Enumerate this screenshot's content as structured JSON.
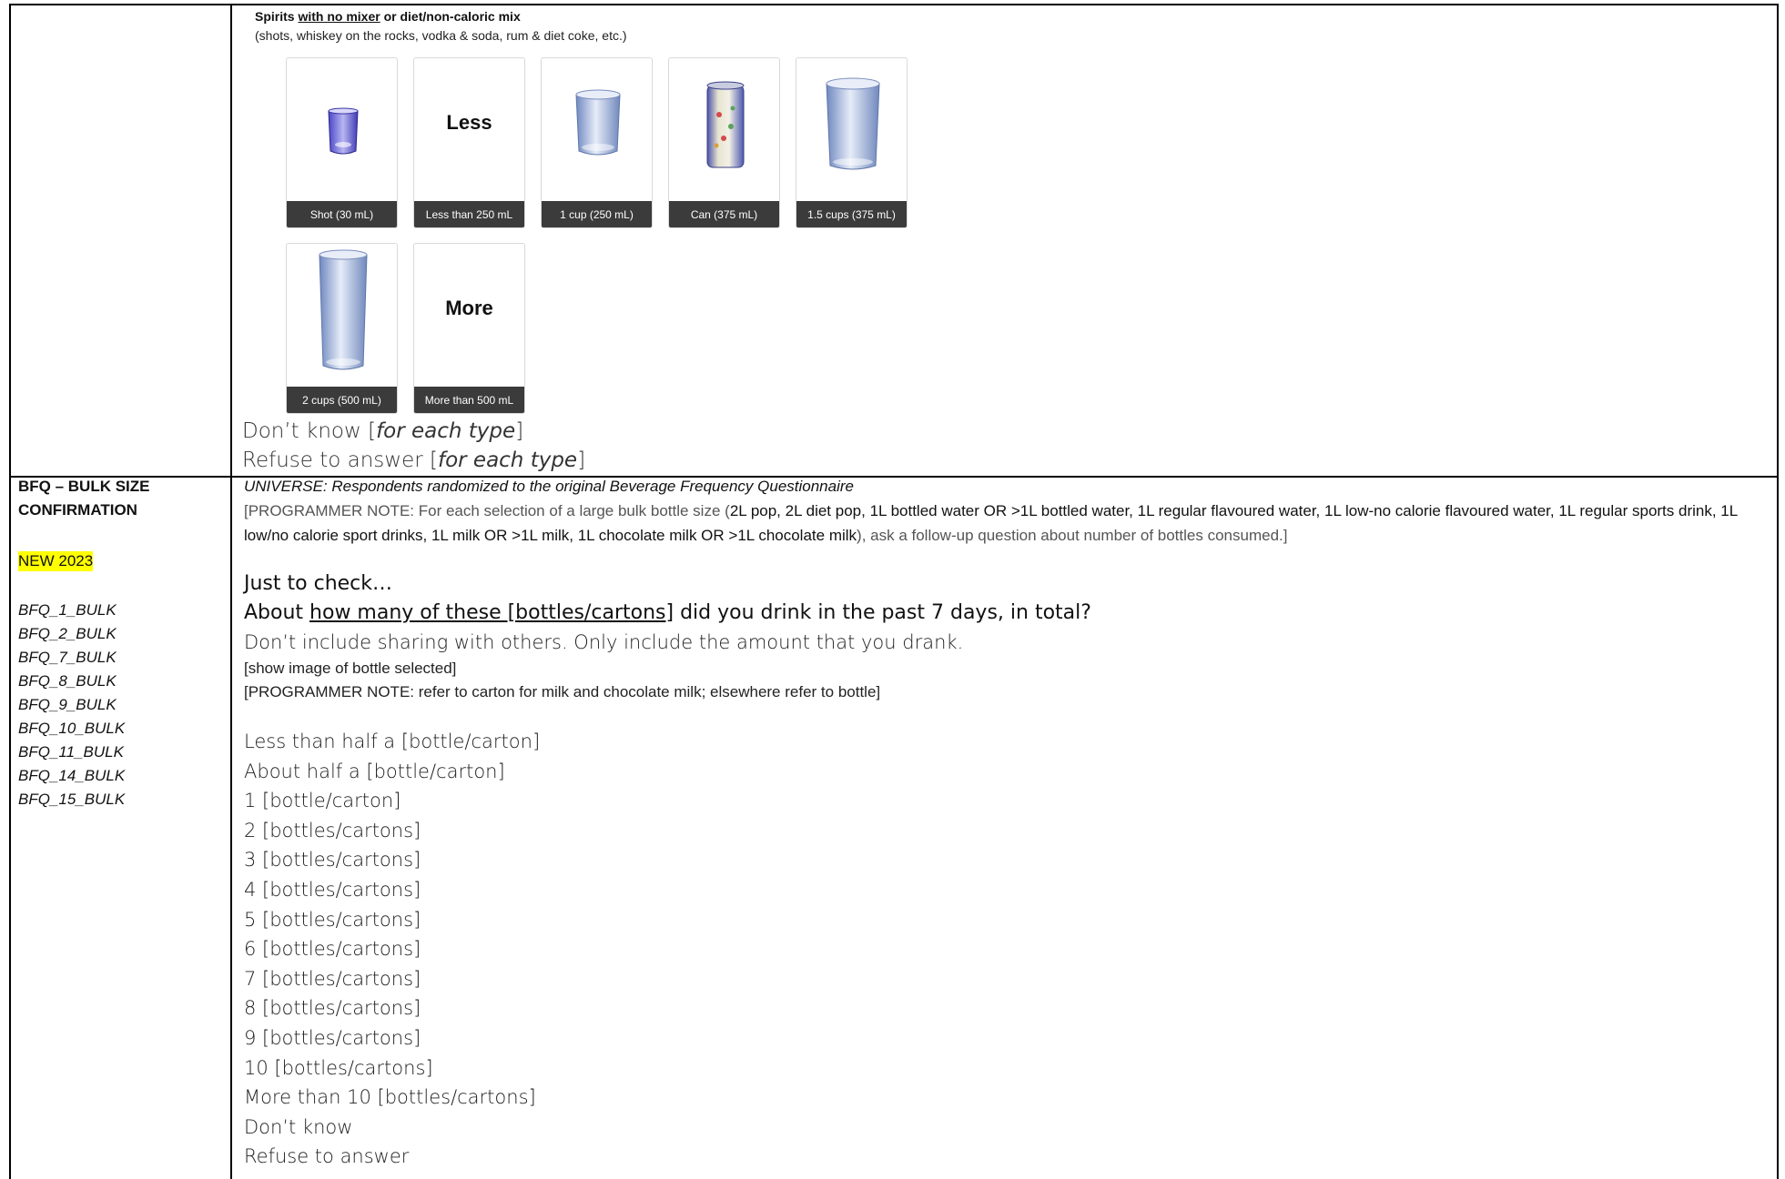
{
  "top": {
    "title_pre": "Spirits ",
    "title_underlined": "with no mixer",
    "title_post": " or diet/non-caloric mix",
    "subtitle": "(shots, whiskey on the rocks, vodka & soda, rum & diet coke, etc.)",
    "cards": [
      {
        "caption": "Shot (30 mL)",
        "icon": "shot-glass-icon"
      },
      {
        "caption": "Less than 250 mL",
        "word": "Less"
      },
      {
        "caption": "1 cup (250 mL)",
        "icon": "small-cup-icon"
      },
      {
        "caption": "Can (375 mL)",
        "icon": "can-icon"
      },
      {
        "caption": "1.5 cups (375 mL)",
        "icon": "medium-cup-icon"
      },
      {
        "caption": "2 cups (500 mL)",
        "icon": "tall-glass-icon"
      },
      {
        "caption": "More than 500 mL",
        "word": "More"
      }
    ],
    "dont_know": "Don’t know [",
    "dont_know_italic": "for each type",
    "dont_know_end": "]",
    "refuse": "Refuse to answer [",
    "refuse_italic": "for each type",
    "refuse_end": "]"
  },
  "left": {
    "title_line1": "BFQ – BULK SIZE",
    "title_line2": "CONFIRMATION",
    "badge": "NEW 2023",
    "codes": [
      "BFQ_1_BULK",
      "BFQ_2_BULK",
      "BFQ_7_BULK",
      "BFQ_8_BULK",
      "BFQ_9_BULK",
      "BFQ_10_BULK",
      "BFQ_11_BULK",
      "BFQ_14_BULK",
      "BFQ_15_BULK"
    ]
  },
  "main": {
    "universe": "UNIVERSE: Respondents randomized to the original Beverage Frequency Questionnaire",
    "note_a": "[PROGRAMMER NOTE: For each selection of a large bulk bottle size (",
    "note_b": "2L pop, 2L diet pop, 1L bottled water OR >1L bottled water, 1L regular flavoured water, 1L low-no calorie flavoured water, 1L regular sports drink, 1L low/no calorie sport drinks, 1L milk OR >1L milk, 1L chocolate milk OR >1L chocolate milk",
    "note_c": "), ask a follow-up question about number of bottles consumed.]",
    "check": "Just to check…",
    "q_pre": "About ",
    "q_underlined": "how many of these [bottles/cartons]",
    "q_post": " did you drink in the past 7 days, in total?",
    "q_instruction": "Don’t include sharing with others. Only include the amount that you drank.",
    "show_image": "[show image of bottle selected]",
    "prog_note2": "[PROGRAMMER NOTE: refer to carton for milk and chocolate milk; elsewhere refer to bottle]",
    "options": [
      "Less than half a [bottle/carton]",
      "About half a [bottle/carton]",
      "1 [bottle/carton]",
      "2 [bottles/cartons]",
      "3 [bottles/cartons]",
      "4 [bottles/cartons]",
      "5 [bottles/cartons]",
      "6 [bottles/cartons]",
      "7 [bottles/cartons]",
      "8 [bottles/cartons]",
      "9 [bottles/cartons]",
      "10 [bottles/cartons]",
      "More than 10 [bottles/cartons]",
      "Don’t know",
      "Refuse to answer"
    ]
  }
}
